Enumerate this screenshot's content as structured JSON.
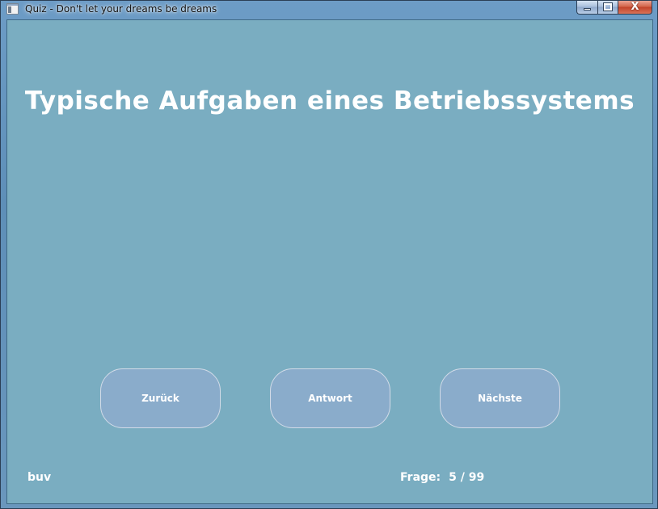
{
  "window": {
    "title": "Quiz - Don't let your dreams be dreams",
    "close_glyph": "X"
  },
  "main": {
    "title": "Typische Aufgaben eines Betriebssystems"
  },
  "buttons": {
    "back_label": "Zurück",
    "answer_label": "Antwort",
    "next_label": "Nächste"
  },
  "footer": {
    "user": "buv",
    "question_label": "Frage:",
    "progress": "5 / 99"
  },
  "colors": {
    "background": "#7aadc1",
    "button_fill": "#8aaccb",
    "text": "#ffffff"
  },
  "icons": [
    "app-icon",
    "minimize-icon",
    "maximize-icon",
    "close-icon"
  ]
}
